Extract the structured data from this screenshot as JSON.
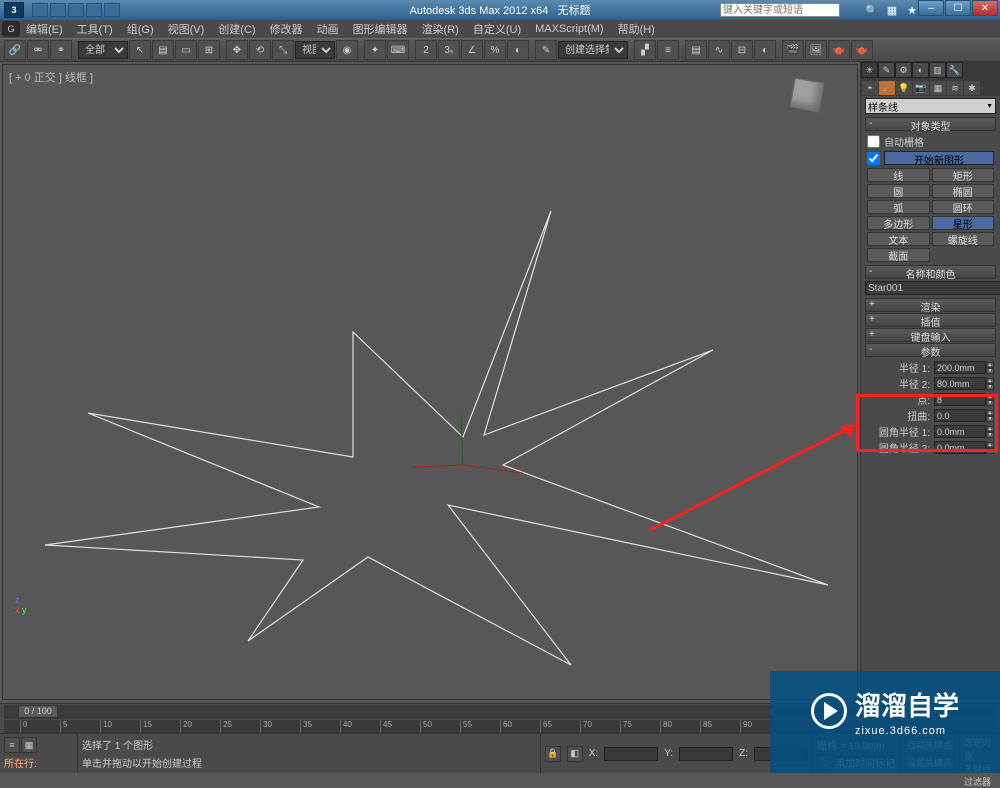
{
  "titlebar": {
    "app_title": "Autodesk 3ds Max 2012 x64",
    "doc_title": "无标题",
    "search_placeholder": "键入关键字或短语"
  },
  "menu": {
    "edit": "编辑(E)",
    "tools": "工具(T)",
    "group": "组(G)",
    "views": "视图(V)",
    "create": "创建(C)",
    "modifiers": "修改器",
    "animation": "动画",
    "graph": "图形编辑器",
    "render": "渲染(R)",
    "customize": "自定义(U)",
    "maxscript": "MAXScript(M)",
    "help": "帮助(H)"
  },
  "toolbar": {
    "scope": "全部",
    "view": "视图",
    "sel_set": "创建选择集"
  },
  "viewport": {
    "label": "[ + 0 正交 ] 线框 ]"
  },
  "panel": {
    "category": "样条线",
    "object_type_header": "对象类型",
    "autogrid": "自动栅格",
    "start_new": "开始新图形",
    "name_color_header": "名称和颜色",
    "object_name": "Star001",
    "render_header": "渲染",
    "interp_header": "插值",
    "keyboard_header": "键盘输入",
    "params_header": "参数",
    "shapes": {
      "line": "线",
      "rect": "矩形",
      "circle": "圆",
      "ellipse": "椭圆",
      "arc": "弧",
      "donut": "圆环",
      "ngon": "多边形",
      "star": "星形",
      "text": "文本",
      "helix": "螺旋线",
      "section": "截面"
    },
    "params": {
      "radius1_label": "半径 1:",
      "radius1_val": "200.0mm",
      "radius2_label": "半径 2:",
      "radius2_val": "80.0mm",
      "points_label": "点:",
      "points_val": "8",
      "distortion_label": "扭曲:",
      "distortion_val": "0.0",
      "fillet1_label": "圆角半径 1:",
      "fillet1_val": "0.0mm",
      "fillet2_label": "圆角半径 2:",
      "fillet2_val": "0.0mm"
    }
  },
  "time": {
    "thumb": "0 / 100",
    "ticks": [
      "0",
      "5",
      "10",
      "15",
      "20",
      "25",
      "30",
      "35",
      "40",
      "45",
      "50",
      "55",
      "60",
      "65",
      "70",
      "75",
      "80",
      "85",
      "90"
    ]
  },
  "status": {
    "selected": "选择了 1 个图形",
    "hint": "单击并拖动以开始创建过程",
    "x": "X:",
    "y": "Y:",
    "z": "Z:",
    "grid": "栅格 = 10.0mm",
    "autokey": "自动关键点",
    "setkey": "设置关键点",
    "sel_locked": "选定对象",
    "in_place": "所在行:",
    "add_tag": "添加时间标记",
    "key_filter": "关键点过滤器"
  },
  "watermark": {
    "brand": "溜溜自学",
    "url": "zixue.3d66.com"
  }
}
